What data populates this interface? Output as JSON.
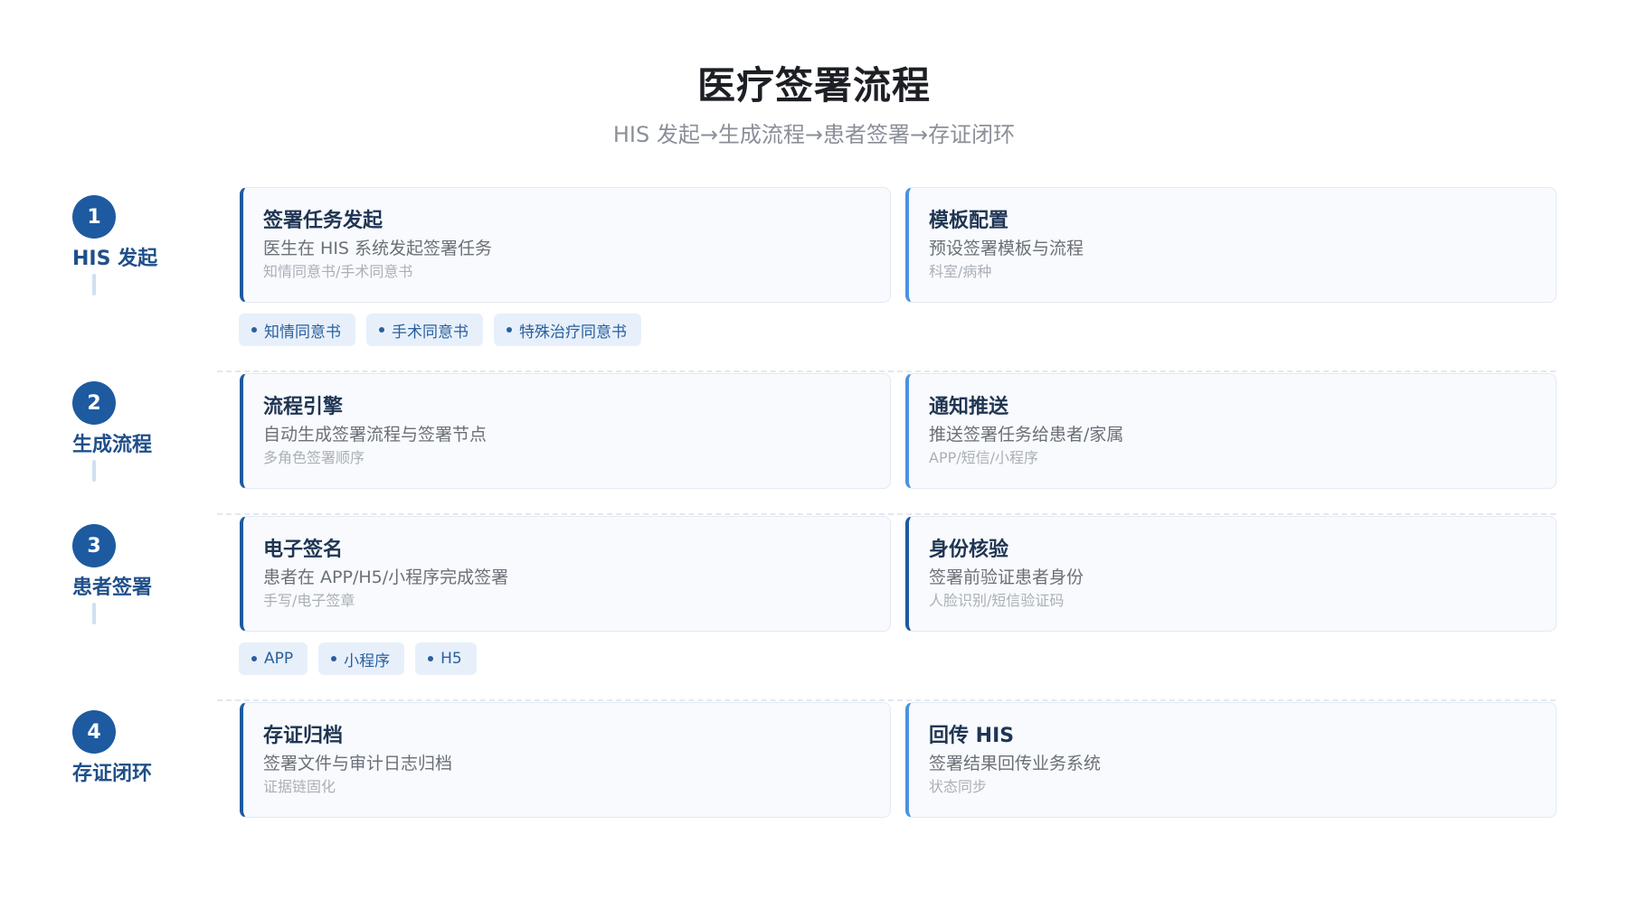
{
  "header": {
    "title": "医疗签署流程",
    "subtitle": "HIS 发起→生成流程→患者签署→存证闭环"
  },
  "steps": [
    {
      "number": "1",
      "name": "HIS 发起",
      "cards": [
        {
          "title": "签署任务发起",
          "desc": "医生在 HIS 系统发起签署任务",
          "note": "知情同意书/手术同意书"
        },
        {
          "title": "模板配置",
          "desc": "预设签署模板与流程",
          "note": "科室/病种"
        }
      ],
      "tags": [
        "知情同意书",
        "手术同意书",
        "特殊治疗同意书"
      ]
    },
    {
      "number": "2",
      "name": "生成流程",
      "cards": [
        {
          "title": "流程引擎",
          "desc": "自动生成签署流程与签署节点",
          "note": "多角色签署顺序"
        },
        {
          "title": "通知推送",
          "desc": "推送签署任务给患者/家属",
          "note": "APP/短信/小程序"
        }
      ]
    },
    {
      "number": "3",
      "name": "患者签署",
      "cards": [
        {
          "title": "电子签名",
          "desc": "患者在 APP/H5/小程序完成签署",
          "note": "手写/电子签章"
        },
        {
          "title": "身份核验",
          "desc": "签署前验证患者身份",
          "note": "人脸识别/短信验证码"
        }
      ],
      "tags": [
        "APP",
        "小程序",
        "H5"
      ]
    },
    {
      "number": "4",
      "name": "存证闭环",
      "cards": [
        {
          "title": "存证归档",
          "desc": "签署文件与审计日志归档",
          "note": "证据链固化"
        },
        {
          "title": "回传 HIS",
          "desc": "签署结果回传业务系统",
          "note": "状态同步"
        }
      ]
    }
  ]
}
